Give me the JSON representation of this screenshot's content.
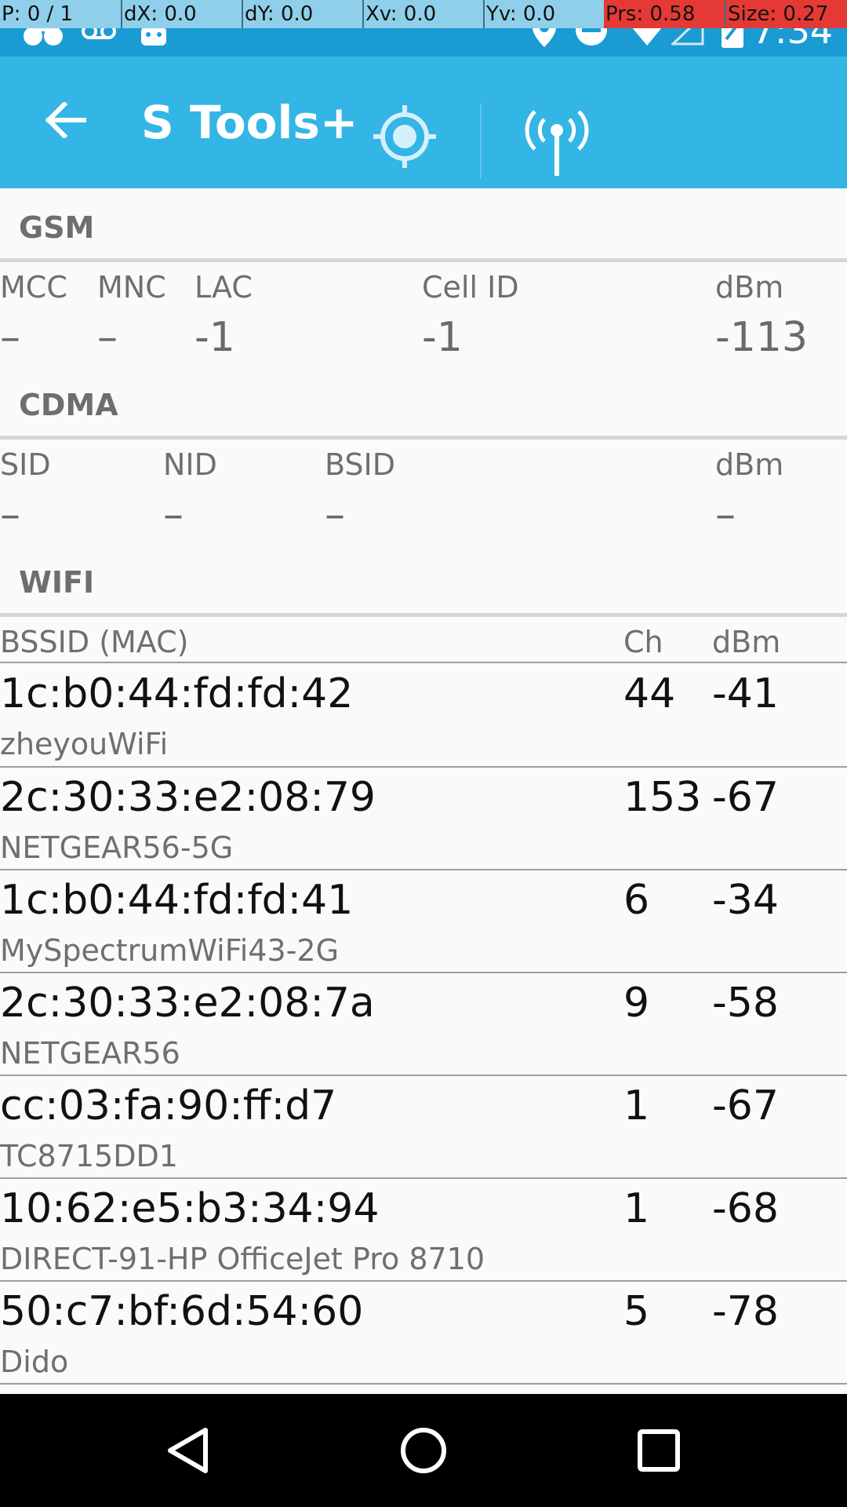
{
  "debug_overlay": {
    "cells": [
      "P: 0 / 1",
      "dX: 0.0",
      "dY: 0.0",
      "Xv: 0.0",
      "Yv: 0.0",
      "Prs: 0.58",
      "Size: 0.27"
    ]
  },
  "status_bar": {
    "time": "7:34",
    "icons": [
      "blackberry-icon",
      "voicemail-icon",
      "android-icon",
      "location-pin-icon",
      "do-not-disturb-icon",
      "wifi-icon",
      "cell-signal-icon",
      "battery-icon"
    ]
  },
  "app_bar": {
    "title": "S Tools+",
    "back_icon": "arrow-back-icon",
    "tab_icons": [
      "gps-target-icon",
      "cell-tower-icon"
    ],
    "color": "#33b5e5"
  },
  "gsm": {
    "header": "GSM",
    "labels": {
      "mcc": "MCC",
      "mnc": "MNC",
      "lac": "LAC",
      "cell_id": "Cell ID",
      "dbm": "dBm"
    },
    "values": {
      "mcc": "–",
      "mnc": "–",
      "lac": "-1",
      "cell_id": "-1",
      "dbm": "-113"
    }
  },
  "cdma": {
    "header": "CDMA",
    "labels": {
      "sid": "SID",
      "nid": "NID",
      "bsid": "BSID",
      "dbm": "dBm"
    },
    "values": {
      "sid": "–",
      "nid": "–",
      "bsid": "–",
      "dbm": "–"
    }
  },
  "wifi": {
    "header": "WIFI",
    "columns": {
      "bssid": "BSSID (MAC)",
      "ch": "Ch",
      "dbm": "dBm"
    },
    "rows": [
      {
        "mac": "1c:b0:44:fd:fd:42",
        "ssid": "zheyouWiFi",
        "ch": "44",
        "dbm": "-41"
      },
      {
        "mac": "2c:30:33:e2:08:79",
        "ssid": "NETGEAR56-5G",
        "ch": "153",
        "dbm": "-67"
      },
      {
        "mac": "1c:b0:44:fd:fd:41",
        "ssid": "MySpectrumWiFi43-2G",
        "ch": "6",
        "dbm": "-34"
      },
      {
        "mac": "2c:30:33:e2:08:7a",
        "ssid": "NETGEAR56",
        "ch": "9",
        "dbm": "-58"
      },
      {
        "mac": "cc:03:fa:90:ff:d7",
        "ssid": "TC8715DD1",
        "ch": "1",
        "dbm": "-67"
      },
      {
        "mac": "10:62:e5:b3:34:94",
        "ssid": "DIRECT-91-HP OfficeJet Pro 8710",
        "ch": "1",
        "dbm": "-68"
      },
      {
        "mac": "50:c7:bf:6d:54:60",
        "ssid": "Dido",
        "ch": "5",
        "dbm": "-78"
      }
    ]
  },
  "nav_bar": {
    "icons": [
      "nav-back-icon",
      "nav-home-icon",
      "nav-recents-icon"
    ]
  }
}
